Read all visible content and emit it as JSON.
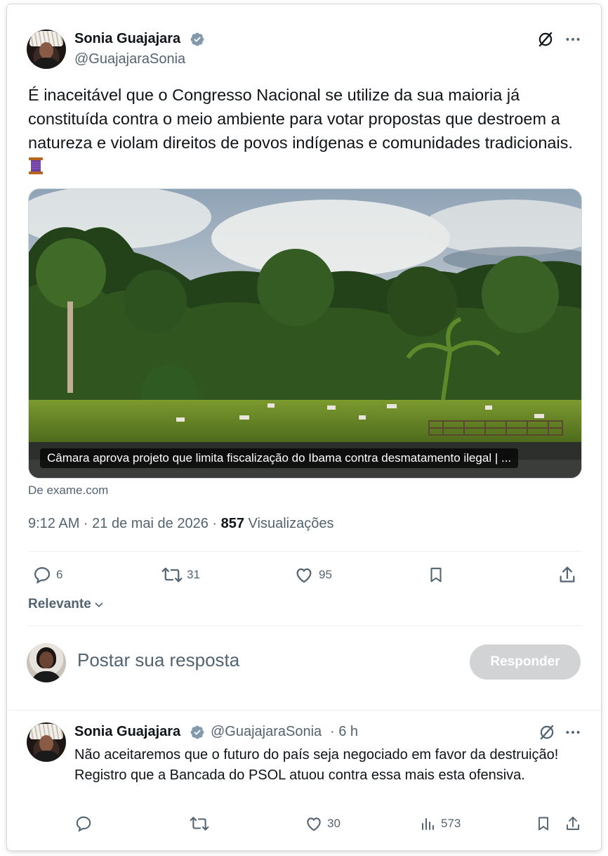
{
  "tweet": {
    "author_name": "Sonia Guajajara",
    "author_handle": "@GuajajaraSonia",
    "text": "É inaceitável que o Congresso Nacional se utilize da sua maioria já constituída contra o meio ambiente para votar propostas que destroem a natureza e violam direitos de povos indígenas e comunidades tradicionais.",
    "emoji_icon": "thread-spool-icon",
    "card": {
      "caption": "Câmara aprova projeto que limita fiscalização do Ibama contra desmatamento ilegal | ...",
      "source": "De exame.com"
    },
    "time": "9:12 AM · 21 de mai de 2026 · ",
    "views_count": "857",
    "views_label": " Visualizações",
    "actions": {
      "replies": "6",
      "reposts": "31",
      "likes": "95"
    }
  },
  "sort": {
    "label": "Relevante"
  },
  "composer": {
    "placeholder": "Postar sua resposta",
    "button_label": "Responder"
  },
  "reply": {
    "author_name": "Sonia Guajajara",
    "author_handle": "@GuajajaraSonia",
    "time": "· 6 h",
    "text": "Não aceitaremos que o futuro do país seja negociado em favor da destruição! Registro que a Bancada do PSOL atuou contra essa mais esta ofensiva.",
    "actions": {
      "likes": "30",
      "views": "573"
    }
  },
  "colors": {
    "text": "#0f1419",
    "muted": "#536471",
    "verified": "#829aab",
    "button_disabled": "#d1d3d5"
  }
}
